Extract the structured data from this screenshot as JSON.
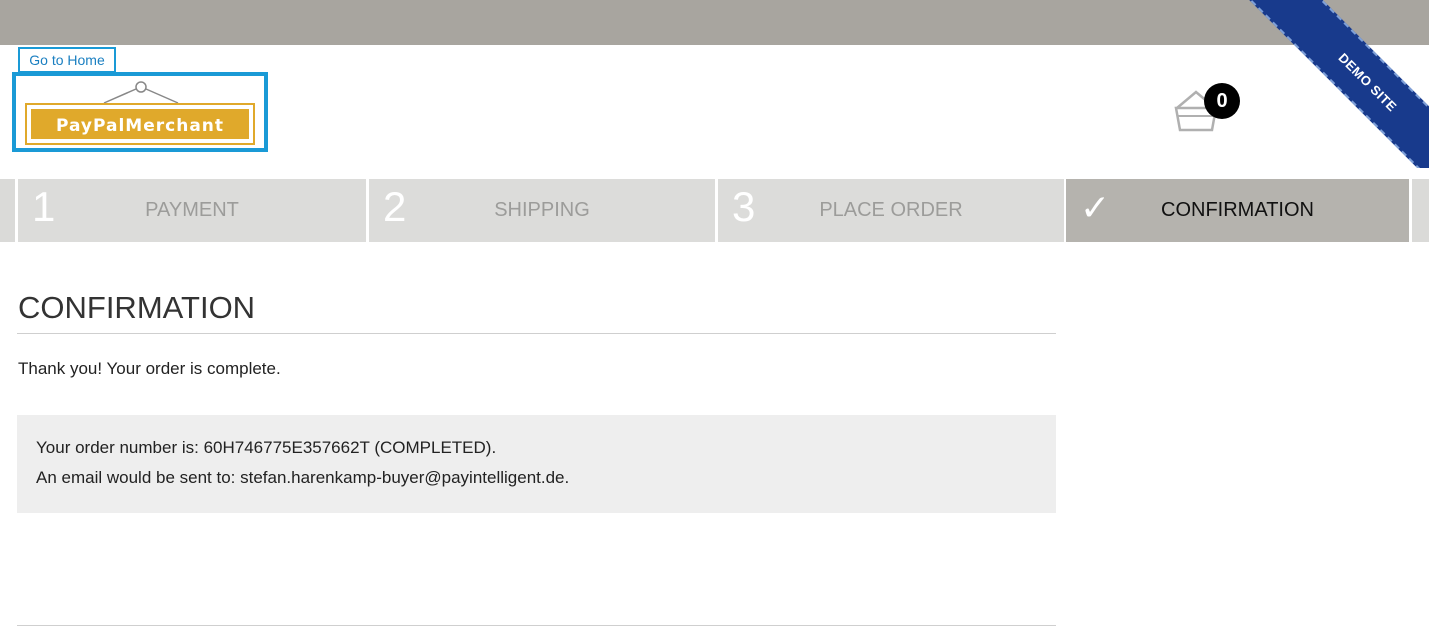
{
  "header": {
    "home_link": "Go to Home",
    "logo_text": "PayPalMerchant",
    "cart_count": "0",
    "ribbon_text": "DEMO SITE"
  },
  "steps": [
    {
      "num": "1",
      "label": "PAYMENT",
      "active": false
    },
    {
      "num": "2",
      "label": "SHIPPING",
      "active": false
    },
    {
      "num": "3",
      "label": "PLACE ORDER",
      "active": false
    },
    {
      "num": "✓",
      "label": "CONFIRMATION",
      "active": true
    }
  ],
  "main": {
    "title": "CONFIRMATION",
    "thanks": "Thank you! Your order is complete.",
    "order_line": "Your order number is: 60H746775E357662T (COMPLETED).",
    "email_line": "An email would be sent to: stefan.harenkamp-buyer@payintelligent.de."
  },
  "colors": {
    "accent": "#1a9ad6",
    "ribbon": "#183a8c",
    "logo_gold": "#e0a92b"
  }
}
